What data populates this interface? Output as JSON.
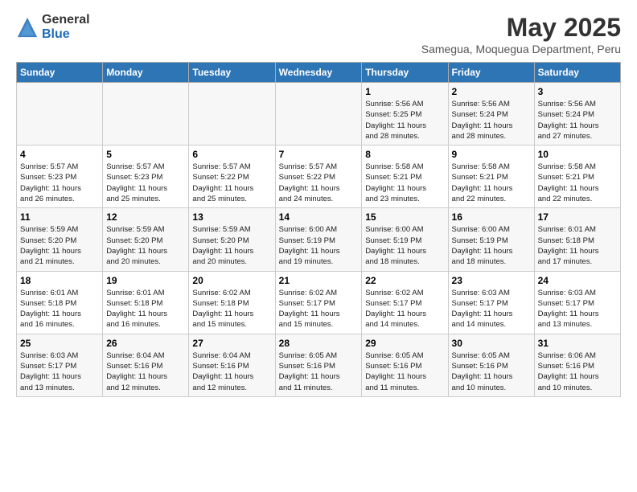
{
  "logo": {
    "general": "General",
    "blue": "Blue"
  },
  "header": {
    "month_title": "May 2025",
    "subtitle": "Samegua, Moquegua Department, Peru"
  },
  "weekdays": [
    "Sunday",
    "Monday",
    "Tuesday",
    "Wednesday",
    "Thursday",
    "Friday",
    "Saturday"
  ],
  "weeks": [
    [
      {
        "day": "",
        "info": ""
      },
      {
        "day": "",
        "info": ""
      },
      {
        "day": "",
        "info": ""
      },
      {
        "day": "",
        "info": ""
      },
      {
        "day": "1",
        "info": "Sunrise: 5:56 AM\nSunset: 5:25 PM\nDaylight: 11 hours\nand 28 minutes."
      },
      {
        "day": "2",
        "info": "Sunrise: 5:56 AM\nSunset: 5:24 PM\nDaylight: 11 hours\nand 28 minutes."
      },
      {
        "day": "3",
        "info": "Sunrise: 5:56 AM\nSunset: 5:24 PM\nDaylight: 11 hours\nand 27 minutes."
      }
    ],
    [
      {
        "day": "4",
        "info": "Sunrise: 5:57 AM\nSunset: 5:23 PM\nDaylight: 11 hours\nand 26 minutes."
      },
      {
        "day": "5",
        "info": "Sunrise: 5:57 AM\nSunset: 5:23 PM\nDaylight: 11 hours\nand 25 minutes."
      },
      {
        "day": "6",
        "info": "Sunrise: 5:57 AM\nSunset: 5:22 PM\nDaylight: 11 hours\nand 25 minutes."
      },
      {
        "day": "7",
        "info": "Sunrise: 5:57 AM\nSunset: 5:22 PM\nDaylight: 11 hours\nand 24 minutes."
      },
      {
        "day": "8",
        "info": "Sunrise: 5:58 AM\nSunset: 5:21 PM\nDaylight: 11 hours\nand 23 minutes."
      },
      {
        "day": "9",
        "info": "Sunrise: 5:58 AM\nSunset: 5:21 PM\nDaylight: 11 hours\nand 22 minutes."
      },
      {
        "day": "10",
        "info": "Sunrise: 5:58 AM\nSunset: 5:21 PM\nDaylight: 11 hours\nand 22 minutes."
      }
    ],
    [
      {
        "day": "11",
        "info": "Sunrise: 5:59 AM\nSunset: 5:20 PM\nDaylight: 11 hours\nand 21 minutes."
      },
      {
        "day": "12",
        "info": "Sunrise: 5:59 AM\nSunset: 5:20 PM\nDaylight: 11 hours\nand 20 minutes."
      },
      {
        "day": "13",
        "info": "Sunrise: 5:59 AM\nSunset: 5:20 PM\nDaylight: 11 hours\nand 20 minutes."
      },
      {
        "day": "14",
        "info": "Sunrise: 6:00 AM\nSunset: 5:19 PM\nDaylight: 11 hours\nand 19 minutes."
      },
      {
        "day": "15",
        "info": "Sunrise: 6:00 AM\nSunset: 5:19 PM\nDaylight: 11 hours\nand 18 minutes."
      },
      {
        "day": "16",
        "info": "Sunrise: 6:00 AM\nSunset: 5:19 PM\nDaylight: 11 hours\nand 18 minutes."
      },
      {
        "day": "17",
        "info": "Sunrise: 6:01 AM\nSunset: 5:18 PM\nDaylight: 11 hours\nand 17 minutes."
      }
    ],
    [
      {
        "day": "18",
        "info": "Sunrise: 6:01 AM\nSunset: 5:18 PM\nDaylight: 11 hours\nand 16 minutes."
      },
      {
        "day": "19",
        "info": "Sunrise: 6:01 AM\nSunset: 5:18 PM\nDaylight: 11 hours\nand 16 minutes."
      },
      {
        "day": "20",
        "info": "Sunrise: 6:02 AM\nSunset: 5:18 PM\nDaylight: 11 hours\nand 15 minutes."
      },
      {
        "day": "21",
        "info": "Sunrise: 6:02 AM\nSunset: 5:17 PM\nDaylight: 11 hours\nand 15 minutes."
      },
      {
        "day": "22",
        "info": "Sunrise: 6:02 AM\nSunset: 5:17 PM\nDaylight: 11 hours\nand 14 minutes."
      },
      {
        "day": "23",
        "info": "Sunrise: 6:03 AM\nSunset: 5:17 PM\nDaylight: 11 hours\nand 14 minutes."
      },
      {
        "day": "24",
        "info": "Sunrise: 6:03 AM\nSunset: 5:17 PM\nDaylight: 11 hours\nand 13 minutes."
      }
    ],
    [
      {
        "day": "25",
        "info": "Sunrise: 6:03 AM\nSunset: 5:17 PM\nDaylight: 11 hours\nand 13 minutes."
      },
      {
        "day": "26",
        "info": "Sunrise: 6:04 AM\nSunset: 5:16 PM\nDaylight: 11 hours\nand 12 minutes."
      },
      {
        "day": "27",
        "info": "Sunrise: 6:04 AM\nSunset: 5:16 PM\nDaylight: 11 hours\nand 12 minutes."
      },
      {
        "day": "28",
        "info": "Sunrise: 6:05 AM\nSunset: 5:16 PM\nDaylight: 11 hours\nand 11 minutes."
      },
      {
        "day": "29",
        "info": "Sunrise: 6:05 AM\nSunset: 5:16 PM\nDaylight: 11 hours\nand 11 minutes."
      },
      {
        "day": "30",
        "info": "Sunrise: 6:05 AM\nSunset: 5:16 PM\nDaylight: 11 hours\nand 10 minutes."
      },
      {
        "day": "31",
        "info": "Sunrise: 6:06 AM\nSunset: 5:16 PM\nDaylight: 11 hours\nand 10 minutes."
      }
    ]
  ]
}
